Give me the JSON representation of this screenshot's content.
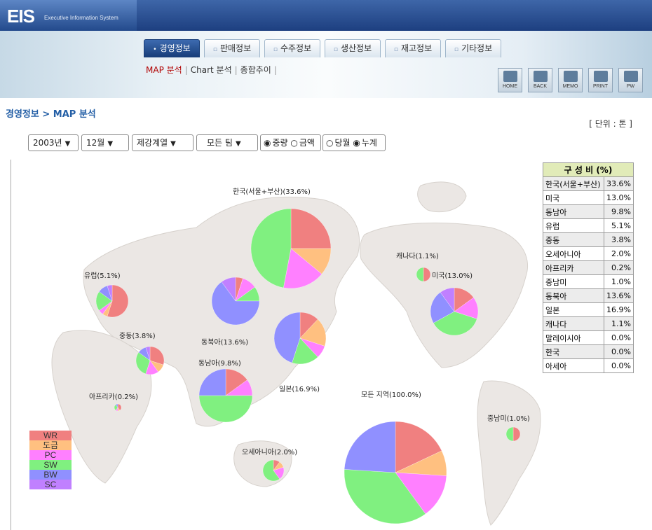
{
  "app": {
    "logo": "EIS",
    "logo_sub": "Executive Information System"
  },
  "tabs": [
    {
      "label": "경영정보",
      "active": true
    },
    {
      "label": "판매정보",
      "active": false
    },
    {
      "label": "수주정보",
      "active": false
    },
    {
      "label": "생산정보",
      "active": false
    },
    {
      "label": "재고정보",
      "active": false
    },
    {
      "label": "기타정보",
      "active": false
    }
  ],
  "subnav": {
    "items": [
      "MAP 분석",
      "Chart 분석",
      "종합추이"
    ],
    "current": "MAP 분석"
  },
  "toolbar": {
    "home": "HOME",
    "back": "BACK",
    "memo": "MEMO",
    "print": "PRINT",
    "pw": "PW"
  },
  "breadcrumb": "경영정보 > MAP 분석",
  "unit": "[ 단위 : 톤 ]",
  "filters": {
    "year": "2003년",
    "month": "12월",
    "line": "제강계열",
    "team": "모든 팀",
    "measure_options": [
      "중량",
      "금액"
    ],
    "measure_selected": "중량",
    "period_options": [
      "당월",
      "누계"
    ],
    "period_selected": "누계"
  },
  "colors": {
    "WR": "#f08080",
    "도금": "#ffc080",
    "PC": "#ff80ff",
    "SW": "#80f080",
    "BW": "#9090ff",
    "SC": "#c080ff"
  },
  "table": {
    "header": "구 성 비 (%)",
    "rows": [
      [
        "한국(서울+부산)",
        "33.6%"
      ],
      [
        "미국",
        "13.0%"
      ],
      [
        "동남아",
        "9.8%"
      ],
      [
        "유럽",
        "5.1%"
      ],
      [
        "중동",
        "3.8%"
      ],
      [
        "오세아니아",
        "2.0%"
      ],
      [
        "아프리카",
        "0.2%"
      ],
      [
        "중남미",
        "1.0%"
      ],
      [
        "동북아",
        "13.6%"
      ],
      [
        "일본",
        "16.9%"
      ],
      [
        "캐나다",
        "1.1%"
      ],
      [
        "말레이시아",
        "0.0%"
      ],
      [
        "한국",
        "0.0%"
      ],
      [
        "아세아",
        "0.0%"
      ]
    ]
  },
  "legend": [
    "WR",
    "도금",
    "PC",
    "SW",
    "BW",
    "SC"
  ],
  "chart_data": {
    "type": "pie",
    "categories": [
      "WR",
      "도금",
      "PC",
      "SW",
      "BW",
      "SC"
    ],
    "pies": [
      {
        "label": "한국(서울+부산)(33.6%)",
        "share": 33.6,
        "values": [
          25,
          11,
          17,
          47,
          0,
          0
        ]
      },
      {
        "label": "유럽(5.1%)",
        "share": 5.1,
        "values": [
          55,
          5,
          5,
          20,
          10,
          5
        ]
      },
      {
        "label": "중동(3.8%)",
        "share": 3.8,
        "values": [
          30,
          10,
          15,
          30,
          10,
          5
        ]
      },
      {
        "label": "동북아(13.6%)",
        "share": 13.6,
        "values": [
          5,
          0,
          10,
          10,
          65,
          10
        ]
      },
      {
        "label": "일본(16.9%)",
        "share": 16.9,
        "values": [
          12,
          18,
          8,
          17,
          45,
          0
        ]
      },
      {
        "label": "동남아(9.8%)",
        "share": 9.8,
        "values": [
          15,
          0,
          10,
          50,
          25,
          0
        ]
      },
      {
        "label": "아프리카(0.2%)",
        "share": 0.2,
        "values": [
          40,
          10,
          10,
          30,
          10,
          0
        ]
      },
      {
        "label": "오세아니아(2.0%)",
        "share": 2.0,
        "values": [
          10,
          10,
          20,
          60,
          0,
          0
        ]
      },
      {
        "label": "모든 지역(100.0%)",
        "share": 100.0,
        "values": [
          18,
          8,
          14,
          36,
          24,
          0
        ]
      },
      {
        "label": "캐나다(1.1%)",
        "share": 1.1,
        "values": [
          50,
          0,
          0,
          50,
          0,
          0
        ]
      },
      {
        "label": "미국(13.0%)",
        "share": 13.0,
        "values": [
          15,
          0,
          15,
          37,
          23,
          10
        ]
      },
      {
        "label": "중남미(1.0%)",
        "share": 1.0,
        "values": [
          50,
          0,
          0,
          50,
          0,
          0
        ]
      }
    ]
  }
}
